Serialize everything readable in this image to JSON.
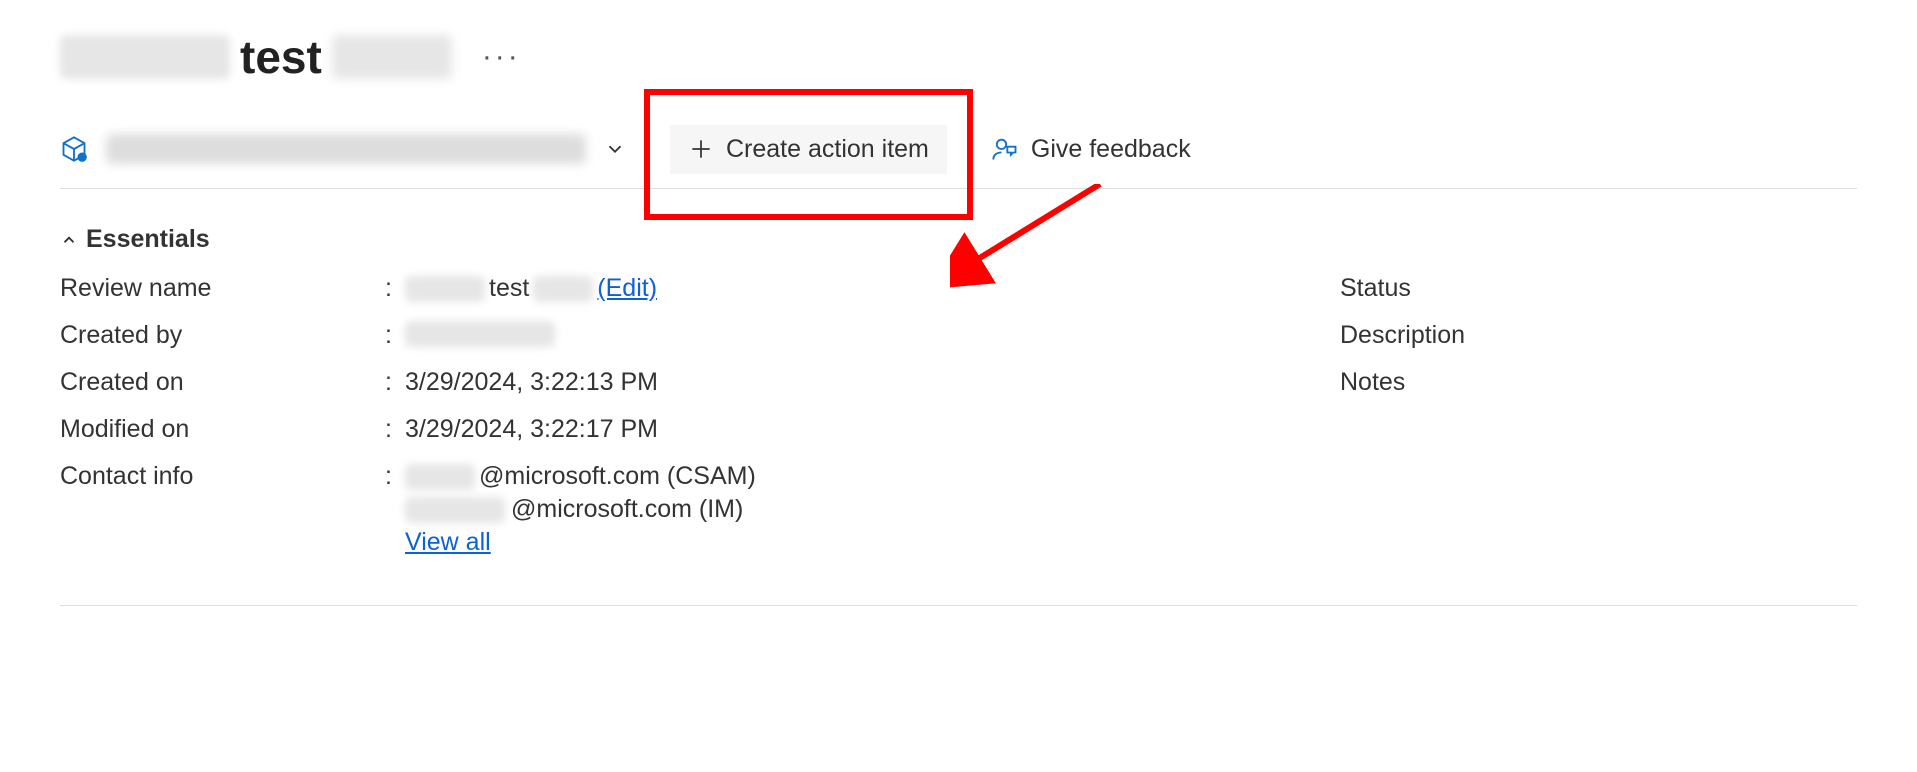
{
  "header": {
    "title_prefix": "",
    "title_mid": "test",
    "title_suffix": "",
    "more_glyph": "···"
  },
  "toolbar": {
    "resource": {
      "label": "",
      "chevron": "˅"
    },
    "create": {
      "label": "Create action item"
    },
    "feedback": {
      "label": "Give feedback"
    }
  },
  "sections": {
    "essentials_label": "Essentials"
  },
  "essentials": {
    "left": {
      "review_name": {
        "label": "Review name",
        "value_prefix": "",
        "value_mid": "test",
        "value_suffix": "",
        "edit_label": "(Edit)"
      },
      "created_by": {
        "label": "Created by",
        "value": ""
      },
      "created_on": {
        "label": "Created on",
        "value": "3/29/2024, 3:22:13 PM"
      },
      "modified_on": {
        "label": "Modified on",
        "value": "3/29/2024, 3:22:17 PM"
      },
      "contact": {
        "label": "Contact info",
        "line1_suffix": "@microsoft.com (CSAM)",
        "line2_suffix": "@microsoft.com (IM)",
        "view_all": "View all"
      }
    },
    "right": {
      "status": {
        "label": "Status"
      },
      "description": {
        "label": "Description"
      },
      "notes": {
        "label": "Notes"
      }
    }
  }
}
